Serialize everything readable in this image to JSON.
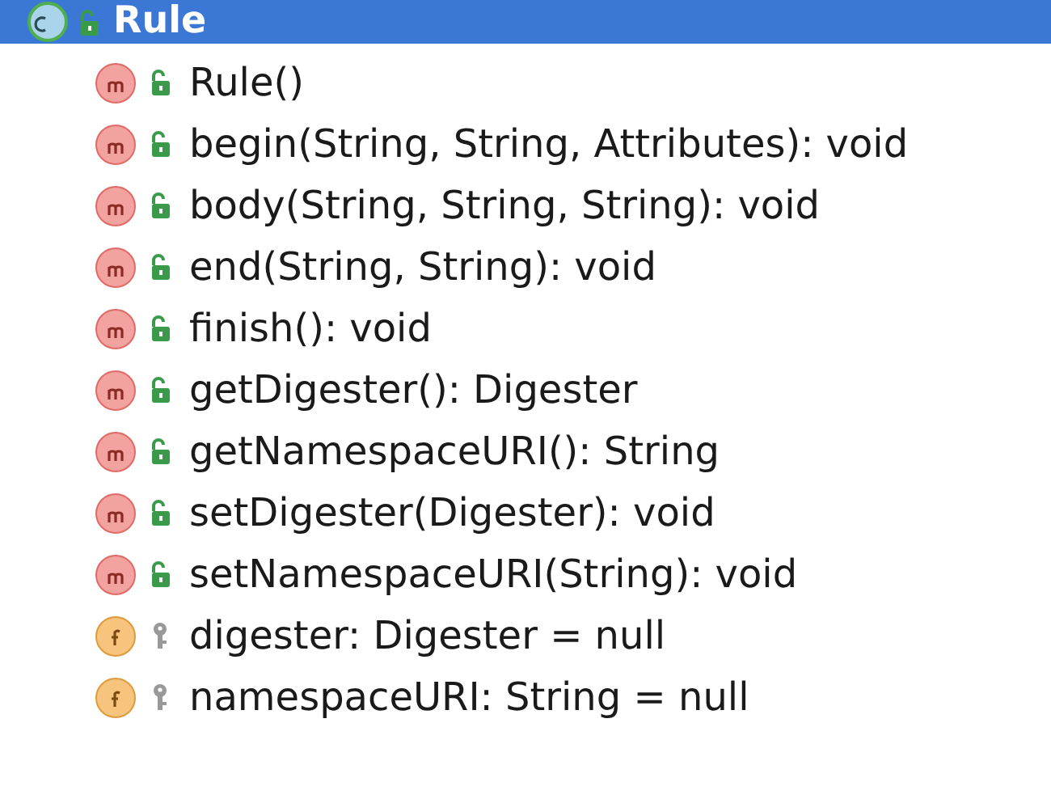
{
  "header": {
    "kind": "class",
    "public": true,
    "label": "Rule"
  },
  "members": [
    {
      "kind": "method",
      "public": true,
      "label": "Rule()"
    },
    {
      "kind": "method",
      "public": true,
      "label": "begin(String, String, Attributes): void"
    },
    {
      "kind": "method",
      "public": true,
      "label": "body(String, String, String): void"
    },
    {
      "kind": "method",
      "public": true,
      "label": "end(String, String): void"
    },
    {
      "kind": "method",
      "public": true,
      "label": "finish(): void"
    },
    {
      "kind": "method",
      "public": true,
      "label": "getDigester(): Digester"
    },
    {
      "kind": "method",
      "public": true,
      "label": "getNamespaceURI(): String"
    },
    {
      "kind": "method",
      "public": true,
      "label": "setDigester(Digester): void"
    },
    {
      "kind": "method",
      "public": true,
      "label": "setNamespaceURI(String): void"
    },
    {
      "kind": "field",
      "public": false,
      "label": "digester: Digester = null"
    },
    {
      "kind": "field",
      "public": false,
      "label": "namespaceURI: String = null"
    }
  ]
}
